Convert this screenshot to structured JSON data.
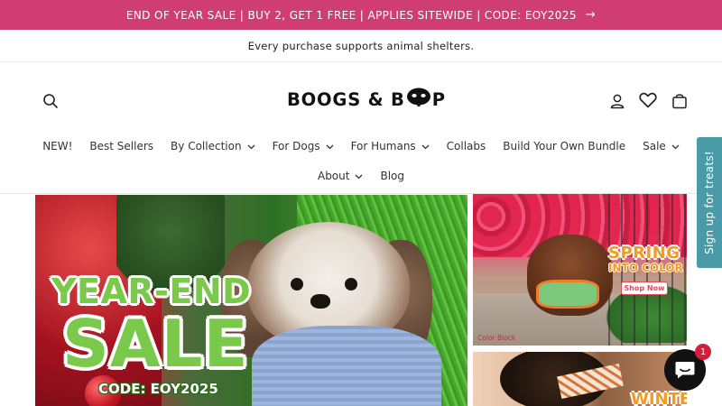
{
  "announcement": {
    "text": "END OF YEAR SALE | BUY 2, GET 1 FREE | APPLIES SITEWIDE | CODE: EOY2025",
    "arrow": "→"
  },
  "subbar": {
    "text": "Every purchase supports animal shelters."
  },
  "header": {
    "logo_text_before": "BOOGS & B",
    "logo_text_after": "P",
    "icons": [
      "search-icon",
      "account-icon",
      "heart-icon",
      "cart-icon"
    ]
  },
  "nav": {
    "row1": [
      {
        "label": "NEW!",
        "dropdown": false
      },
      {
        "label": "Best Sellers",
        "dropdown": false
      },
      {
        "label": "By Collection",
        "dropdown": true
      },
      {
        "label": "For Dogs",
        "dropdown": true
      },
      {
        "label": "For Humans",
        "dropdown": true
      },
      {
        "label": "Collabs",
        "dropdown": false
      },
      {
        "label": "Build Your Own Bundle",
        "dropdown": false
      },
      {
        "label": "Sale",
        "dropdown": true
      }
    ],
    "row2": [
      {
        "label": "About",
        "dropdown": true
      },
      {
        "label": "Blog",
        "dropdown": false
      }
    ],
    "chevron": "⌄"
  },
  "hero": {
    "line1": "YEAR-END",
    "line2": "SALE",
    "code": "CODE: EOY2025"
  },
  "promo_top": {
    "headline1": "SPRING",
    "headline2": "INTO COLOR",
    "button": "Shop Now",
    "caption": "Color Block"
  },
  "promo_bottom": {
    "headline": "WINTER"
  },
  "signup_tab": {
    "label": "Sign up for treats!"
  },
  "chat": {
    "badge_count": "1"
  },
  "colors": {
    "announcement_bg": "#cf3d72",
    "signup_tab_bg": "#4a9aa8",
    "chat_bg": "#111111",
    "badge_bg": "#d21f3c"
  }
}
